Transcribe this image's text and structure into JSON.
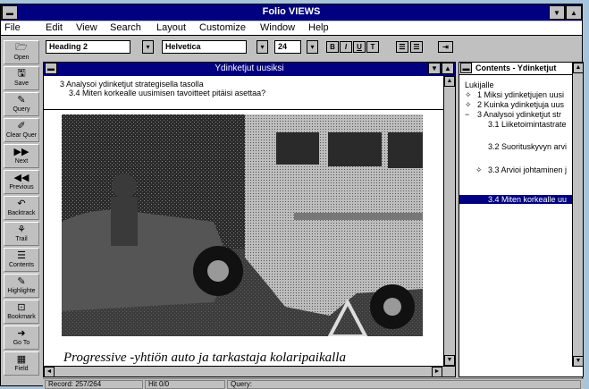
{
  "window": {
    "title": "Folio VIEWS"
  },
  "menu": [
    "File",
    "Edit",
    "View",
    "Search",
    "Layout",
    "Customize",
    "Window",
    "Help"
  ],
  "toolbar": {
    "style": "Heading 2",
    "font": "Helvetica",
    "size": "24",
    "bold": "B",
    "italic": "I",
    "underline": "U",
    "strike": "T"
  },
  "tools": [
    {
      "label": "Open",
      "icon": "open-icon"
    },
    {
      "label": "Save",
      "icon": "save-icon"
    },
    {
      "label": "Query",
      "icon": "query-icon"
    },
    {
      "label": "Clear Quer",
      "icon": "clear-query-icon"
    },
    {
      "label": "Next",
      "icon": "next-icon"
    },
    {
      "label": "Previous",
      "icon": "previous-icon"
    },
    {
      "label": "Backtrack",
      "icon": "backtrack-icon"
    },
    {
      "label": "Trail",
      "icon": "trail-icon"
    },
    {
      "label": "Contents",
      "icon": "contents-icon"
    },
    {
      "label": "Highlighte",
      "icon": "highlighter-icon"
    },
    {
      "label": "Bookmark",
      "icon": "bookmark-icon"
    },
    {
      "label": "Go To",
      "icon": "goto-icon"
    },
    {
      "label": "Field",
      "icon": "field-icon"
    }
  ],
  "document": {
    "title": "Ydinketjut uusiksi",
    "line1": "3  Analysoi ydinketjut strategisella tasolla",
    "line2": "3.4 Miten korkealle uusimisen tavoitteet pitäisi asettaa?",
    "caption": "Progressive -yhtiön auto ja tarkastaja kolaripaikalla"
  },
  "contents": {
    "title": "Contents - Ydinketjut",
    "items": [
      {
        "text": "Lukijalle",
        "marker": ""
      },
      {
        "text": "1 Miksi ydinketjujen uusi",
        "marker": "+"
      },
      {
        "text": "2  Kuinka ydinketjuja uus",
        "marker": "+"
      },
      {
        "text": "3  Analysoi ydinketjut str",
        "marker": "−"
      },
      {
        "text": "3.1 Liiketoimintastrate",
        "marker": ""
      },
      {
        "text": "3.2 Suorituskyvyn arvi",
        "marker": ""
      },
      {
        "text": "3.3 Arvioi johtaminen j",
        "marker": "+"
      },
      {
        "text": "3.4 Miten korkealle uu",
        "marker": ""
      }
    ]
  },
  "status": {
    "record": "Record: 257/264",
    "hit": "Hit 0/0",
    "query": "Query:"
  },
  "colors": {
    "titlebar": "#000080",
    "face": "#c0c0c0",
    "desktop": "#a8c4dc"
  }
}
